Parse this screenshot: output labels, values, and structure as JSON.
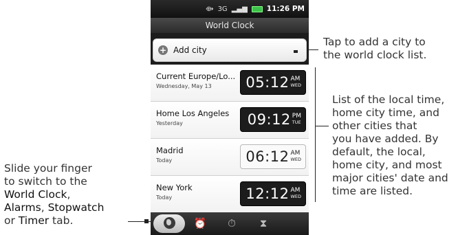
{
  "status_bar": {
    "time": "11:26 PM",
    "network": "3G",
    "icons": [
      "gps-icon",
      "signal-icon",
      "battery-icon"
    ]
  },
  "app": {
    "title": "World Clock"
  },
  "add_city": {
    "label": "Add city"
  },
  "cities": [
    {
      "name": "Current  Europe/Lo...",
      "sub": "Wednesday, May 13",
      "time": "05:12",
      "ampm": "AM",
      "day": "WED",
      "style": "dark"
    },
    {
      "name": "Home  Los Angeles",
      "sub": "Yesterday",
      "time": "09:12",
      "ampm": "PM",
      "day": "TUE",
      "style": "dark"
    },
    {
      "name": "Madrid",
      "sub": "Today",
      "time": "06:12",
      "ampm": "AM",
      "day": "WED",
      "style": "light"
    },
    {
      "name": "New York",
      "sub": "Today",
      "time": "12:12",
      "ampm": "AM",
      "day": "WED",
      "style": "dark"
    }
  ],
  "tabs": [
    {
      "name": "World Clock",
      "icon": "globe-icon",
      "active": true
    },
    {
      "name": "Alarms",
      "icon": "alarm-clock-icon",
      "active": false
    },
    {
      "name": "Stopwatch",
      "icon": "stopwatch-icon",
      "active": false
    },
    {
      "name": "Timer",
      "icon": "hourglass-icon",
      "active": false
    }
  ],
  "callouts": {
    "add_city": {
      "line1": "Tap to add a city to",
      "line2": "the world clock list."
    },
    "list": {
      "lines": [
        "List of the local time,",
        "home city time, and",
        "other cities that",
        "you have added. By",
        "default, the local,",
        "home city, and most",
        "major cities' date and",
        "time are listed."
      ]
    },
    "tabs": {
      "line1": "Slide your finger",
      "line2": "to switch to the",
      "world_clock": "World Clock",
      "comma": ",",
      "alarms": "Alarms",
      "stopwatch": "Stopwatch",
      "or": "or",
      "timer": "Timer",
      "tab_word": "tab."
    }
  }
}
